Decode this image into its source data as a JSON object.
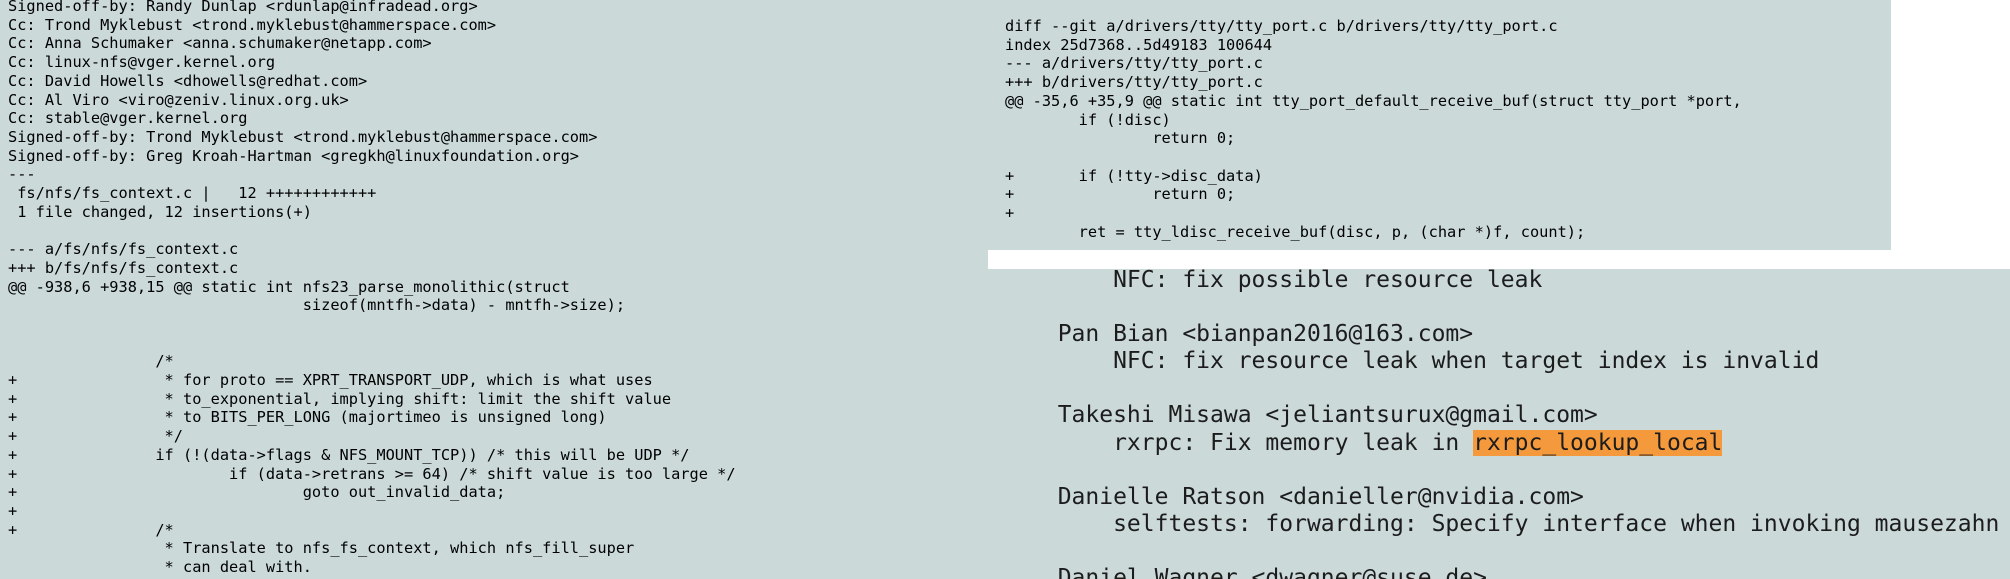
{
  "colors": {
    "background": "#cbd9d9",
    "divider": "#ffffff",
    "highlight": "#f59a3c",
    "text": "#000000"
  },
  "patch_email": {
    "lines": [
      "Signed-off-by: Randy Dunlap <rdunlap@infradead.org>",
      "Cc: Trond Myklebust <trond.myklebust@hammerspace.com>",
      "Cc: Anna Schumaker <anna.schumaker@netapp.com>",
      "Cc: linux-nfs@vger.kernel.org",
      "Cc: David Howells <dhowells@redhat.com>",
      "Cc: Al Viro <viro@zeniv.linux.org.uk>",
      "Cc: stable@vger.kernel.org",
      "Signed-off-by: Trond Myklebust <trond.myklebust@hammerspace.com>",
      "Signed-off-by: Greg Kroah-Hartman <gregkh@linuxfoundation.org>",
      "---",
      " fs/nfs/fs_context.c |   12 ++++++++++++",
      " 1 file changed, 12 insertions(+)",
      "",
      "--- a/fs/nfs/fs_context.c",
      "+++ b/fs/nfs/fs_context.c",
      "@@ -938,6 +938,15 @@ static int nfs23_parse_monolithic(struct",
      "                                sizeof(mntfh->data) - mntfh->size);",
      "",
      "",
      "                /*",
      "+                * for proto == XPRT_TRANSPORT_UDP, which is what uses",
      "+                * to_exponential, implying shift: limit the shift value",
      "+                * to BITS_PER_LONG (majortimeo is unsigned long)",
      "+                */",
      "+               if (!(data->flags & NFS_MOUNT_TCP)) /* this will be UDP */",
      "+                       if (data->retrans >= 64) /* shift value is too large */",
      "+                               goto out_invalid_data;",
      "+",
      "+               /*",
      "                 * Translate to nfs_fs_context, which nfs_fill_super",
      "                 * can deal with.",
      "                 */"
    ]
  },
  "tty_diff": {
    "lines": [
      "diff --git a/drivers/tty/tty_port.c b/drivers/tty/tty_port.c",
      "index 25d7368..5d49183 100644",
      "--- a/drivers/tty/tty_port.c",
      "+++ b/drivers/tty/tty_port.c",
      "@@ -35,6 +35,9 @@ static int tty_port_default_receive_buf(struct tty_port *port,",
      "        if (!disc)",
      "                return 0;",
      "",
      "+       if (!tty->disc_data)",
      "+               return 0;",
      "+",
      "        ret = tty_ldisc_receive_buf(disc, p, (char *)f, count);"
    ]
  },
  "shortlog": {
    "lines": [
      {
        "text": "      NFC: fix possible resource leak"
      },
      {
        "text": ""
      },
      {
        "text": "  Pan Bian <bianpan2016@163.com>"
      },
      {
        "text": "      NFC: fix resource leak when target index is invalid"
      },
      {
        "text": ""
      },
      {
        "text": "  Takeshi Misawa <jeliantsurux@gmail.com>"
      },
      {
        "text": "      rxrpc: Fix memory leak in ",
        "highlight": "rxrpc_lookup_local"
      },
      {
        "text": ""
      },
      {
        "text": "  Danielle Ratson <danieller@nvidia.com>"
      },
      {
        "text": "      selftests: forwarding: Specify interface when invoking mausezahn"
      },
      {
        "text": ""
      },
      {
        "text": "  Daniel Wagner <dwagner@suse.de>"
      }
    ]
  }
}
